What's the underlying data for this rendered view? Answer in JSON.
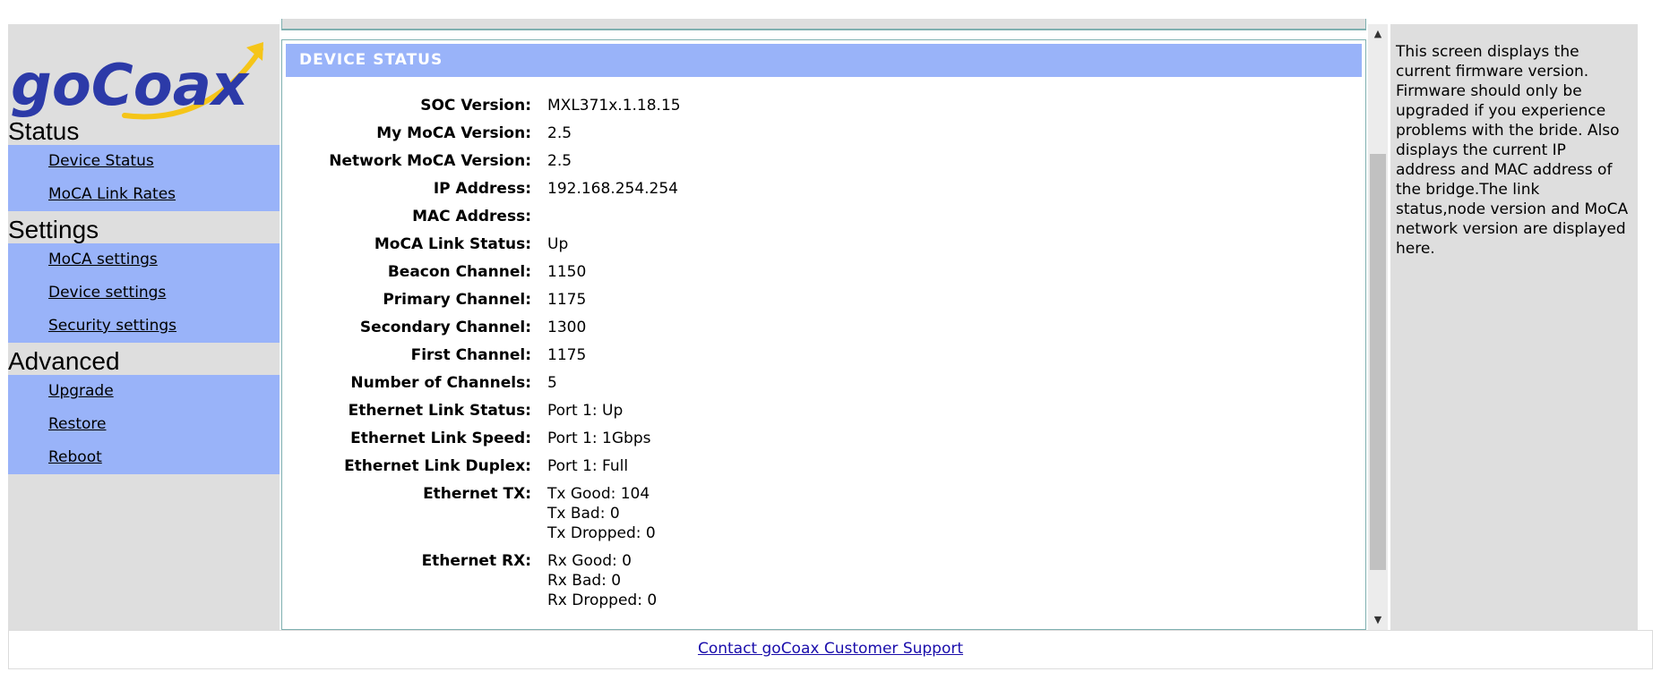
{
  "brand": {
    "logo_text": "goCoax",
    "colors": {
      "logo_blue": "#2c3aa8",
      "logo_arrow": "#f5c518",
      "nav_bg": "#99b3f9",
      "panel_bg": "#dedede"
    }
  },
  "sidebar": {
    "sections": [
      {
        "heading": "Status",
        "items": [
          {
            "label": "Device Status"
          },
          {
            "label": "MoCA Link Rates"
          }
        ]
      },
      {
        "heading": "Settings",
        "items": [
          {
            "label": "MoCA settings"
          },
          {
            "label": "Device settings"
          },
          {
            "label": "Security settings"
          }
        ]
      },
      {
        "heading": "Advanced",
        "items": [
          {
            "label": "Upgrade"
          },
          {
            "label": "Restore"
          },
          {
            "label": "Reboot"
          }
        ]
      }
    ]
  },
  "main": {
    "header": "DEVICE STATUS",
    "rows": [
      {
        "label": "SOC Version:",
        "value": "MXL371x.1.18.15"
      },
      {
        "label": "My MoCA Version:",
        "value": "2.5"
      },
      {
        "label": "Network MoCA Version:",
        "value": "2.5"
      },
      {
        "label": "IP Address:",
        "value": "192.168.254.254"
      },
      {
        "label": "MAC Address:",
        "value": ""
      },
      {
        "label": "MoCA Link Status:",
        "value": "Up"
      },
      {
        "label": "Beacon Channel:",
        "value": "1150"
      },
      {
        "label": "Primary Channel:",
        "value": "1175"
      },
      {
        "label": "Secondary Channel:",
        "value": "1300"
      },
      {
        "label": "First Channel:",
        "value": "1175"
      },
      {
        "label": "Number of Channels:",
        "value": "5"
      },
      {
        "label": "Ethernet Link Status:",
        "value": "Port 1: Up"
      },
      {
        "label": "Ethernet Link Speed:",
        "value": "Port 1: 1Gbps"
      },
      {
        "label": "Ethernet Link Duplex:",
        "value": "Port 1: Full"
      }
    ],
    "ethernet_tx": {
      "label": "Ethernet TX:",
      "lines": [
        "Tx Good: 104",
        "Tx Bad: 0",
        "Tx Dropped: 0"
      ]
    },
    "ethernet_rx": {
      "label": "Ethernet RX:",
      "lines": [
        "Rx Good: 0",
        "Rx Bad: 0",
        "Rx Dropped: 0"
      ]
    }
  },
  "help": {
    "text": "This screen displays the current firmware version. Firmware should only be upgraded if you experience problems with the bride. Also displays the current IP address and MAC address of the bridge.The link status,node version and MoCA network version are displayed here."
  },
  "footer": {
    "link_label": "Contact goCoax Customer Support"
  },
  "scrollbar": {
    "up_icon": "triangle-up",
    "down_icon": "triangle-down"
  }
}
